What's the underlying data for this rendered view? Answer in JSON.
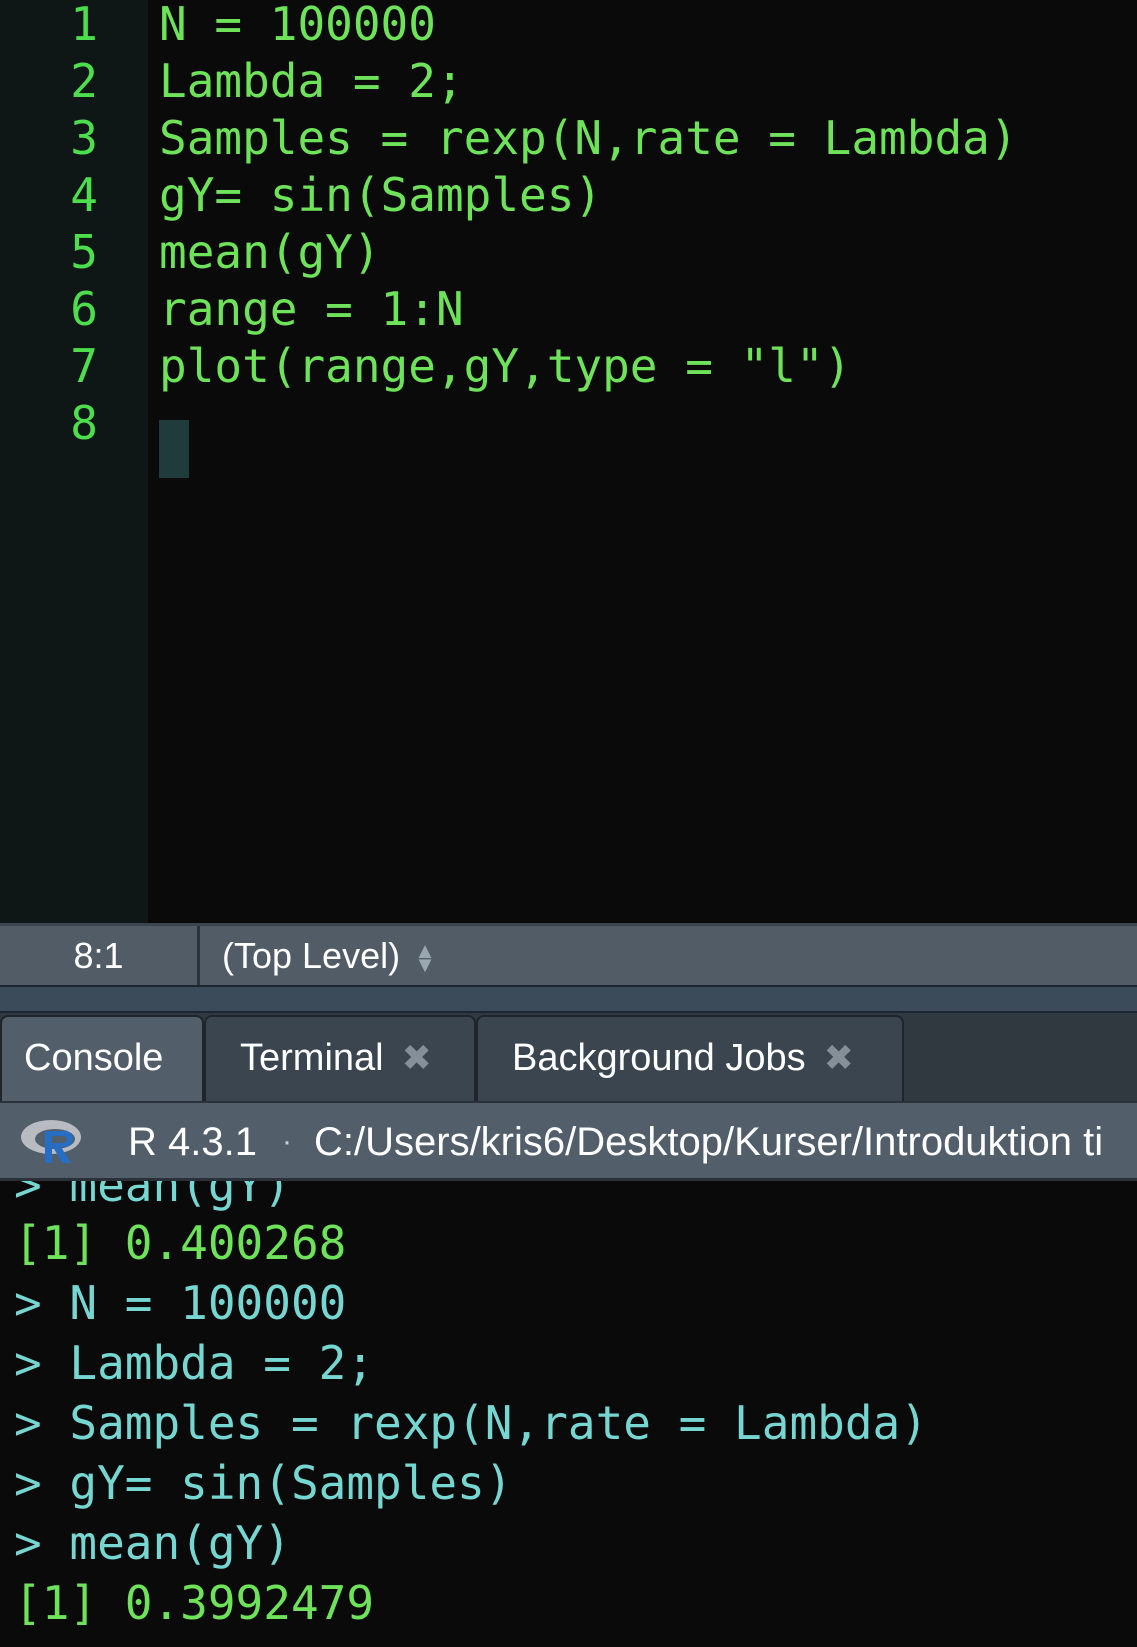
{
  "editor": {
    "line_numbers": [
      "1",
      "2",
      "3",
      "4",
      "5",
      "6",
      "7",
      "8"
    ],
    "lines": [
      "N = 100000",
      "Lambda = 2;",
      "Samples = rexp(N,rate = Lambda)",
      "gY= sin(Samples)",
      "mean(gY)",
      "range = 1:N",
      "plot(range,gY,type = \"l\")",
      ""
    ]
  },
  "status_bar": {
    "cursor_position": "8:1",
    "scope": "(Top Level)",
    "scope_icon": "updown-arrows-icon"
  },
  "tabs": [
    {
      "label": "Console",
      "active": true,
      "closable": false
    },
    {
      "label": "Terminal",
      "active": false,
      "closable": true
    },
    {
      "label": "Background Jobs",
      "active": false,
      "closable": true
    }
  ],
  "console_header": {
    "r_version": "R 4.3.1",
    "separator": "·",
    "working_dir": "C:/Users/kris6/Desktop/Kurser/Introduktion ti"
  },
  "console": {
    "lines": [
      {
        "text": "> mean(gY)",
        "kind": "in"
      },
      {
        "text": "[1] 0.400268",
        "kind": "out"
      },
      {
        "text": "> N = 100000",
        "kind": "in"
      },
      {
        "text": "> Lambda = 2;",
        "kind": "in"
      },
      {
        "text": "> Samples = rexp(N,rate = Lambda)",
        "kind": "in"
      },
      {
        "text": "> gY= sin(Samples)",
        "kind": "in"
      },
      {
        "text": "> mean(gY)",
        "kind": "in"
      },
      {
        "text": "[1] 0.3992479",
        "kind": "out"
      }
    ]
  },
  "colors": {
    "code_green": "#6ee35a",
    "console_input": "#76d6d1",
    "line_number": "#4cde4c",
    "editor_bg": "#0a0a0a",
    "status_bg": "#515c67"
  }
}
